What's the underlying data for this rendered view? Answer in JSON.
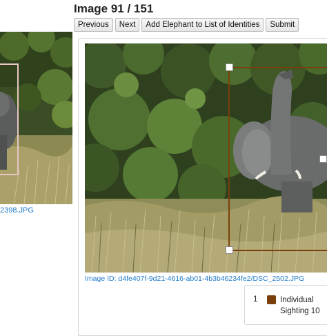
{
  "header": {
    "title": "Image 91 / 151"
  },
  "toolbar": {
    "previous_label": "Previous",
    "next_label": "Next",
    "add_label": "Add Elephant to List of Identities",
    "submit_label": "Submit"
  },
  "left_preview": {
    "caption": "2398.JPG"
  },
  "main_image": {
    "image_id_text": "Image ID: d4fe407f-9d21-4616-ab01-4b3b46234fe2/DSC_2502.JPG"
  },
  "legend": {
    "number": "1",
    "label_line1": "Individual",
    "label_line2": "Sighting 10",
    "swatch_color": "#7a3f0a"
  },
  "colors": {
    "link": "#1f7ac9",
    "bbox_main": "#7a3f0a",
    "bbox_preview": "#e7c6c6"
  }
}
